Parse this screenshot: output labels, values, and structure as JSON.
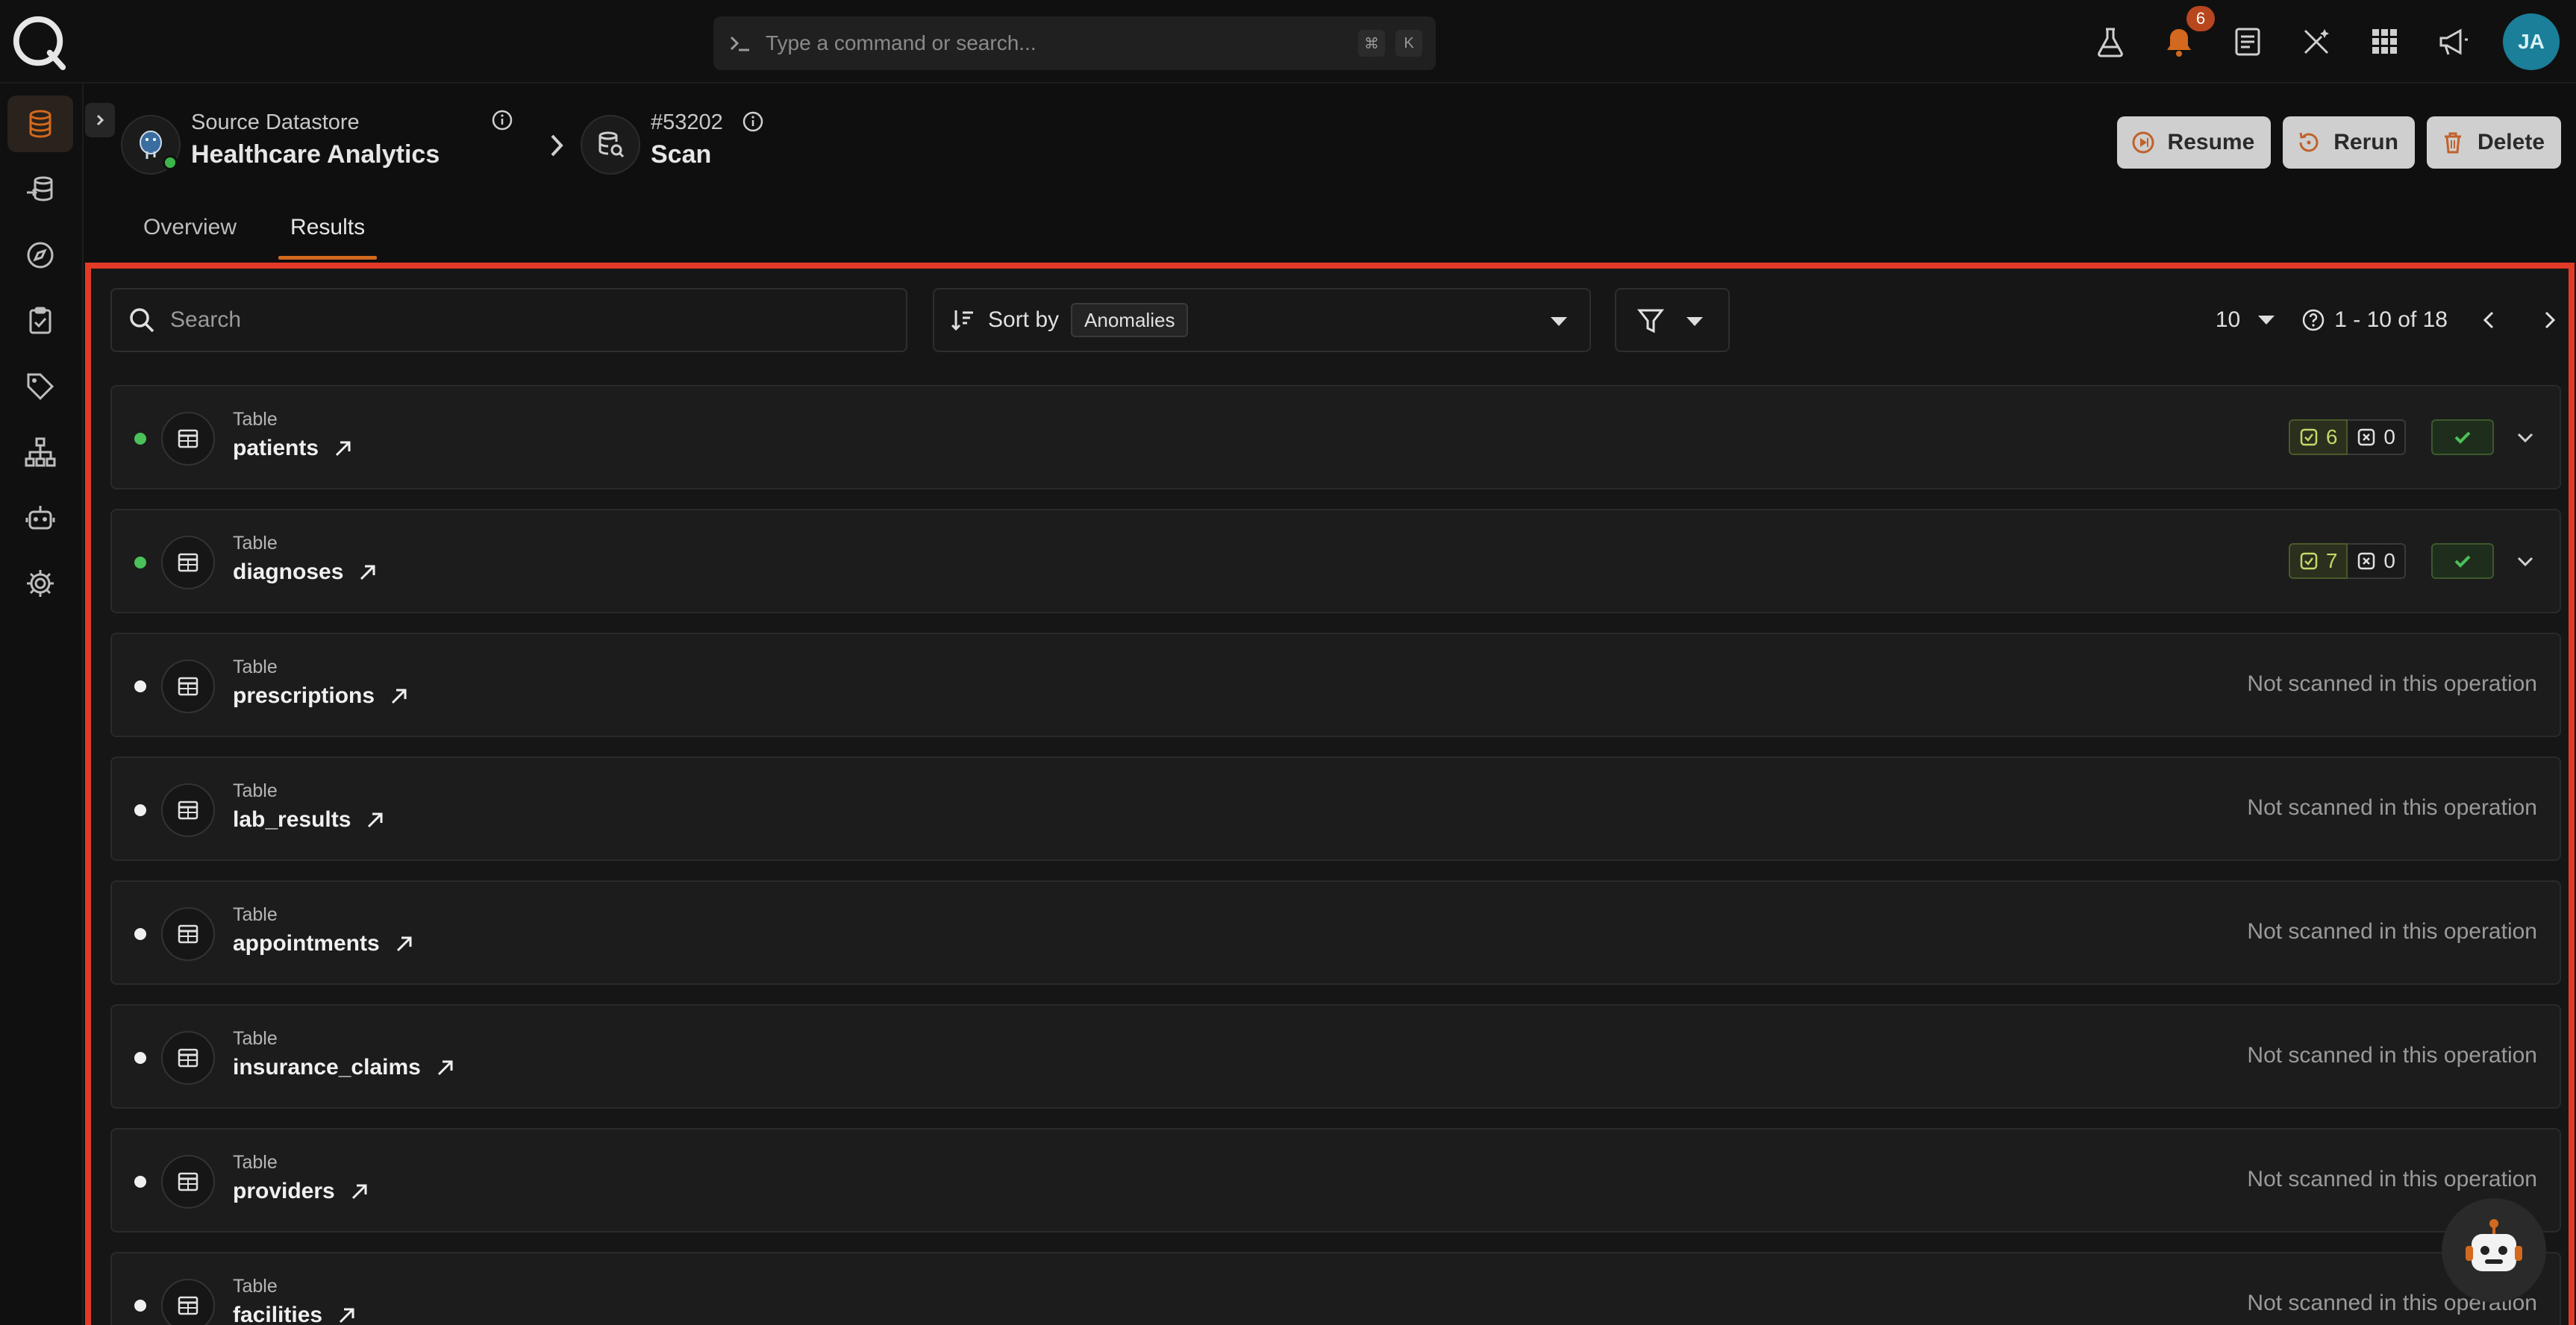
{
  "command_bar": {
    "placeholder": "Type a command or search...",
    "key1": "⌘",
    "key2": "K"
  },
  "notifications": {
    "count": "6"
  },
  "user": {
    "initials": "JA"
  },
  "sidebar": {
    "items": [
      {
        "name": "datastores",
        "icon": "database-icon",
        "active": true
      },
      {
        "name": "flows",
        "icon": "flow-icon"
      },
      {
        "name": "explore",
        "icon": "compass-icon"
      },
      {
        "name": "checks",
        "icon": "clipboard-check-icon"
      },
      {
        "name": "tags",
        "icon": "tag-icon"
      },
      {
        "name": "hierarchy",
        "icon": "sitemap-icon"
      },
      {
        "name": "agents",
        "icon": "robot-icon"
      },
      {
        "name": "settings",
        "icon": "gear-icon"
      }
    ]
  },
  "header": {
    "datastore_label": "Source Datastore",
    "datastore_name": "Healthcare Analytics",
    "scan_id": "#53202",
    "scan_title": "Scan",
    "actions": {
      "resume": "Resume",
      "rerun": "Rerun",
      "delete": "Delete"
    },
    "tabs": [
      "Overview",
      "Results"
    ],
    "active_tab": "Results"
  },
  "toolbar": {
    "search_placeholder": "Search",
    "sort_label": "Sort by",
    "sort_value": "Anomalies",
    "per_page": "10",
    "range": "1 - 10 of 18"
  },
  "rows": [
    {
      "type": "Table",
      "name": "patients",
      "status": "scanned",
      "passed": "6",
      "failed": "0"
    },
    {
      "type": "Table",
      "name": "diagnoses",
      "status": "scanned",
      "passed": "7",
      "failed": "0"
    },
    {
      "type": "Table",
      "name": "prescriptions",
      "status": "Not scanned in this operation"
    },
    {
      "type": "Table",
      "name": "lab_results",
      "status": "Not scanned in this operation"
    },
    {
      "type": "Table",
      "name": "appointments",
      "status": "Not scanned in this operation"
    },
    {
      "type": "Table",
      "name": "insurance_claims",
      "status": "Not scanned in this operation"
    },
    {
      "type": "Table",
      "name": "providers",
      "status": "Not scanned in this operation"
    },
    {
      "type": "Table",
      "name": "facilities",
      "status": "Not scanned in this operation"
    }
  ],
  "colors": {
    "accent": "#d2691e",
    "highlight_border": "#e23a26",
    "ok": "#4bc15a",
    "avatar": "#1b7f99"
  }
}
